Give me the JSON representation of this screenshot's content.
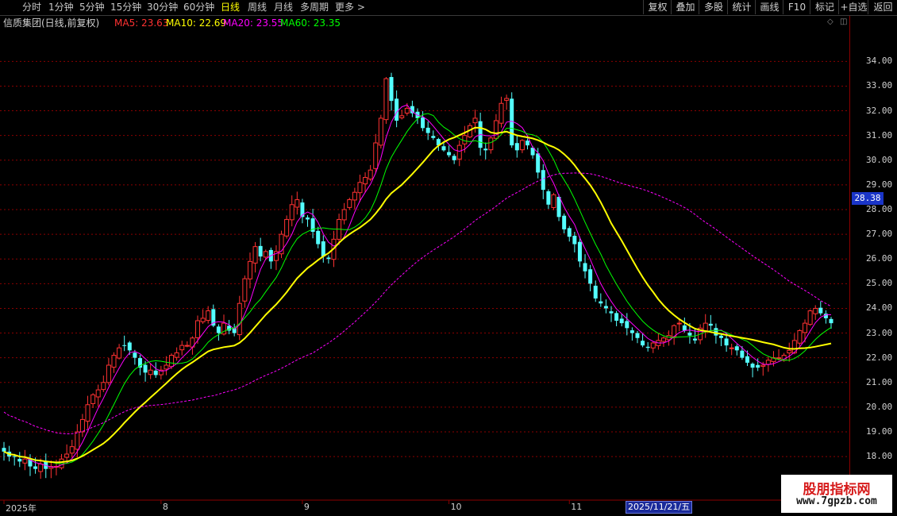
{
  "toolbar": {
    "periods": [
      "分时",
      "1分钟",
      "5分钟",
      "15分钟",
      "30分钟",
      "60分钟",
      "日线",
      "周线",
      "月线",
      "多周期",
      "更多 >"
    ],
    "active_period": "日线",
    "right_buttons": [
      "复权",
      "叠加",
      "多股",
      "统计",
      "画线",
      "F10",
      "标记",
      "+自选",
      "返回"
    ]
  },
  "title": {
    "stock": "信质集团(日线,前复权)",
    "ma5": "MA5: 23.63",
    "ma10": "MA10: 22.69",
    "ma20": "MA20: 23.55",
    "ma60": "MA60: 23.35",
    "corner_icons": [
      "◇",
      "◫"
    ]
  },
  "colors": {
    "up": "#ff3232",
    "down": "#54ffff",
    "ma5": "#ff3232",
    "ma10": "#ffff00",
    "ma20": "#ff00ff",
    "ma60": "#00ff00",
    "grid": "#8b0000",
    "price_tag": "#1a35c8"
  },
  "price_tag": "28.38",
  "cursor_date": "2025/11/21/五",
  "watermark": {
    "line1": "股朋指标网",
    "line2": "www.7gpzb.com"
  },
  "chart_data": {
    "type": "candlestick",
    "ylim": [
      17.2,
      35.2
    ],
    "yticks": [
      "18.00",
      "19.00",
      "20.00",
      "21.00",
      "22.00",
      "23.00",
      "24.00",
      "25.00",
      "26.00",
      "27.00",
      "28.00",
      "29.00",
      "30.00",
      "31.00",
      "32.00",
      "33.00",
      "34.00"
    ],
    "x_labels": [
      {
        "label": "2025年",
        "index": 0
      },
      {
        "label": "8",
        "index": 30
      },
      {
        "label": "9",
        "index": 57
      },
      {
        "label": "10",
        "index": 85
      },
      {
        "label": "11",
        "index": 108
      }
    ],
    "approx_close": [
      18.2,
      18.0,
      18.0,
      17.8,
      17.9,
      17.6,
      17.5,
      17.7,
      17.5,
      17.6,
      17.6,
      17.9,
      18.1,
      18.4,
      19.0,
      19.5,
      20.1,
      20.5,
      20.7,
      21.0,
      21.7,
      22.1,
      22.4,
      22.5,
      22.3,
      22.0,
      21.6,
      21.4,
      21.5,
      21.3,
      21.5,
      21.7,
      22.1,
      22.2,
      22.5,
      22.5,
      22.8,
      23.5,
      23.6,
      23.9,
      23.3,
      23.0,
      23.4,
      23.1,
      23.0,
      24.2,
      25.2,
      25.9,
      26.5,
      26.1,
      26.3,
      25.9,
      26.3,
      27.0,
      27.6,
      28.2,
      28.4,
      27.7,
      27.6,
      27.1,
      26.6,
      26.1,
      26.0,
      26.8,
      27.6,
      28.0,
      28.4,
      28.7,
      29.1,
      29.3,
      29.6,
      30.7,
      31.7,
      33.3,
      32.4,
      31.6,
      31.8,
      32.1,
      31.9,
      31.7,
      31.3,
      31.1,
      30.9,
      30.6,
      30.4,
      30.2,
      30.0,
      30.6,
      31.0,
      31.4,
      31.7,
      30.5,
      30.4,
      30.9,
      31.6,
      32.3,
      32.5,
      30.6,
      30.4,
      30.8,
      30.6,
      30.2,
      29.5,
      28.8,
      28.2,
      28.6,
      27.7,
      27.2,
      26.9,
      26.6,
      25.9,
      25.5,
      25.0,
      24.4,
      24.2,
      24.0,
      23.8,
      23.5,
      23.4,
      23.2,
      23.0,
      22.8,
      22.5,
      22.4,
      22.6,
      22.7,
      22.8,
      22.9,
      23.3,
      23.4,
      23.1,
      22.9,
      22.7,
      23.2,
      23.4,
      23.3,
      22.9,
      22.8,
      22.5,
      22.4,
      22.3,
      22.0,
      21.8,
      21.6,
      21.6,
      21.7,
      21.9,
      22.0,
      22.0,
      22.1,
      22.3,
      22.7,
      23.1,
      23.4,
      23.9,
      24.0,
      23.8,
      23.6,
      23.4
    ]
  }
}
